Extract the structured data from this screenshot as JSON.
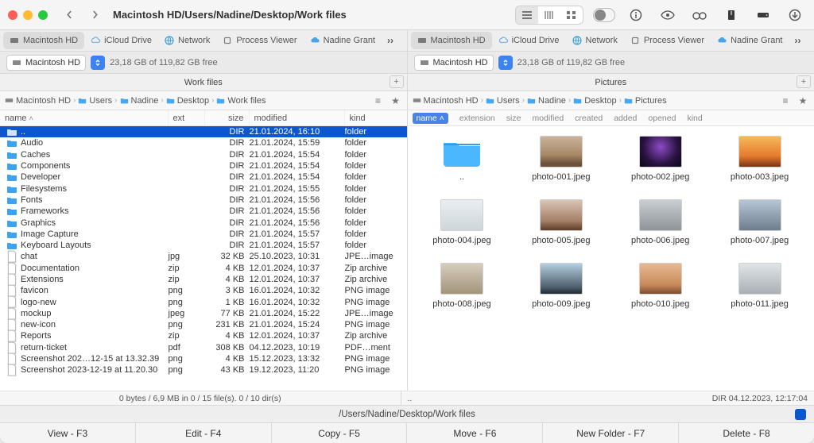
{
  "title_path": "Macintosh HD/Users/Nadine/Desktop/Work files",
  "shortcuts": [
    {
      "label": "Macintosh HD",
      "icon": "drive",
      "active": true
    },
    {
      "label": "iCloud Drive",
      "icon": "cloud"
    },
    {
      "label": "Network",
      "icon": "globe"
    },
    {
      "label": "Process Viewer",
      "icon": "cpu"
    },
    {
      "label": "Nadine Grant",
      "icon": "cloud-user"
    }
  ],
  "drive_label": "Macintosh HD",
  "free_space": "23,18 GB of 119,82 GB free",
  "left_tab": "Work files",
  "right_tab": "Pictures",
  "breadcrumbs_left": [
    "Macintosh HD",
    "Users",
    "Nadine",
    "Desktop",
    "Work files"
  ],
  "breadcrumbs_right": [
    "Macintosh HD",
    "Users",
    "Nadine",
    "Desktop",
    "Pictures"
  ],
  "list_headers": {
    "name": "name",
    "ext": "ext",
    "size": "size",
    "modified": "modified",
    "kind": "kind"
  },
  "grid_headers": [
    "name",
    "extension",
    "size",
    "modified",
    "created",
    "added",
    "opened",
    "kind"
  ],
  "list_rows": [
    {
      "name": "..",
      "ext": "",
      "size": "DIR",
      "mod": "21.01.2024, 16:10",
      "kind": "folder",
      "type": "up",
      "sel": true
    },
    {
      "name": "Audio",
      "ext": "",
      "size": "DIR",
      "mod": "21.01.2024, 15:59",
      "kind": "folder",
      "type": "folder"
    },
    {
      "name": "Caches",
      "ext": "",
      "size": "DIR",
      "mod": "21.01.2024, 15:54",
      "kind": "folder",
      "type": "folder"
    },
    {
      "name": "Components",
      "ext": "",
      "size": "DIR",
      "mod": "21.01.2024, 15:54",
      "kind": "folder",
      "type": "folder"
    },
    {
      "name": "Developer",
      "ext": "",
      "size": "DIR",
      "mod": "21.01.2024, 15:54",
      "kind": "folder",
      "type": "folder"
    },
    {
      "name": "Filesystems",
      "ext": "",
      "size": "DIR",
      "mod": "21.01.2024, 15:55",
      "kind": "folder",
      "type": "folder"
    },
    {
      "name": "Fonts",
      "ext": "",
      "size": "DIR",
      "mod": "21.01.2024, 15:56",
      "kind": "folder",
      "type": "folder"
    },
    {
      "name": "Frameworks",
      "ext": "",
      "size": "DIR",
      "mod": "21.01.2024, 15:56",
      "kind": "folder",
      "type": "folder"
    },
    {
      "name": "Graphics",
      "ext": "",
      "size": "DIR",
      "mod": "21.01.2024, 15:56",
      "kind": "folder",
      "type": "folder"
    },
    {
      "name": "Image Capture",
      "ext": "",
      "size": "DIR",
      "mod": "21.01.2024, 15:57",
      "kind": "folder",
      "type": "folder"
    },
    {
      "name": "Keyboard Layouts",
      "ext": "",
      "size": "DIR",
      "mod": "21.01.2024, 15:57",
      "kind": "folder",
      "type": "folder"
    },
    {
      "name": "chat",
      "ext": "jpg",
      "size": "32 KB",
      "mod": "25.10.2023, 10:31",
      "kind": "JPE…image",
      "type": "file"
    },
    {
      "name": "Documentation",
      "ext": "zip",
      "size": "4 KB",
      "mod": "12.01.2024, 10:37",
      "kind": "Zip archive",
      "type": "file"
    },
    {
      "name": "Extensions",
      "ext": "zip",
      "size": "4 KB",
      "mod": "12.01.2024, 10:37",
      "kind": "Zip archive",
      "type": "file"
    },
    {
      "name": "favicon",
      "ext": "png",
      "size": "3 KB",
      "mod": "16.01.2024, 10:32",
      "kind": "PNG image",
      "type": "file"
    },
    {
      "name": "logo-new",
      "ext": "png",
      "size": "1 KB",
      "mod": "16.01.2024, 10:32",
      "kind": "PNG image",
      "type": "file"
    },
    {
      "name": "mockup",
      "ext": "jpeg",
      "size": "77 KB",
      "mod": "21.01.2024, 15:22",
      "kind": "JPE…image",
      "type": "file"
    },
    {
      "name": "new-icon",
      "ext": "png",
      "size": "231 KB",
      "mod": "21.01.2024, 15:24",
      "kind": "PNG image",
      "type": "file"
    },
    {
      "name": "Reports",
      "ext": "zip",
      "size": "4 KB",
      "mod": "12.01.2024, 10:37",
      "kind": "Zip archive",
      "type": "file"
    },
    {
      "name": "return-ticket",
      "ext": "pdf",
      "size": "308 KB",
      "mod": "04.12.2023, 10:19",
      "kind": "PDF…ment",
      "type": "file"
    },
    {
      "name": "Screenshot 202…12-15 at 13.32.39",
      "ext": "png",
      "size": "4 KB",
      "mod": "15.12.2023, 13:32",
      "kind": "PNG image",
      "type": "file"
    },
    {
      "name": "Screenshot 2023-12-19 at 11.20.30",
      "ext": "png",
      "size": "43 KB",
      "mod": "19.12.2023, 11:20",
      "kind": "PNG image",
      "type": "file"
    }
  ],
  "grid_items": [
    {
      "label": "..",
      "up": true
    },
    {
      "label": "photo-001.jpeg",
      "bg": "linear-gradient(180deg,#c9b39a 0%,#a88967 60%,#6b513a 90%)"
    },
    {
      "label": "photo-002.jpeg",
      "bg": "radial-gradient(circle at 50% 35%,#8b4bc6 0%,#2a1340 60%,#0b0618 100%)"
    },
    {
      "label": "photo-003.jpeg",
      "bg": "linear-gradient(180deg,#f6b85a 0%,#e57a2e 65%,#7a3514 100%)"
    },
    {
      "label": "photo-004.jpeg",
      "bg": "linear-gradient(180deg,#e8eef1 0%,#cfd6da 100%)"
    },
    {
      "label": "photo-005.jpeg",
      "bg": "linear-gradient(180deg,#d9c4b4 0%,#a47e65 70%,#5a3c2a 100%)"
    },
    {
      "label": "photo-006.jpeg",
      "bg": "linear-gradient(180deg,#c8ced2 0%,#8e9498 100%)"
    },
    {
      "label": "photo-007.jpeg",
      "bg": "linear-gradient(180deg,#b6c6d5 0%,#6e7d8c 100%)"
    },
    {
      "label": "photo-008.jpeg",
      "bg": "linear-gradient(180deg,#d7cdbc 0%,#a3947c 100%)"
    },
    {
      "label": "photo-009.jpeg",
      "bg": "linear-gradient(180deg,#b5cfe1 0%,#4b5b68 80%,#1f2a33 100%)"
    },
    {
      "label": "photo-010.jpeg",
      "bg": "linear-gradient(180deg,#e7b993 0%,#c98a5a 70%,#7a4d2f 100%)"
    },
    {
      "label": "photo-011.jpeg",
      "bg": "linear-gradient(180deg,#dfe4e7 0%,#aab0b5 100%)"
    }
  ],
  "left_status": "0 bytes / 6,9 MB in 0 / 15 file(s). 0 / 10 dir(s)",
  "right_status_left": "..",
  "right_status_right": "DIR   04.12.2023, 12:17:04",
  "path_display": "/Users/Nadine/Desktop/Work files",
  "commands": [
    "View - F3",
    "Edit - F4",
    "Copy - F5",
    "Move - F6",
    "New Folder - F7",
    "Delete - F8"
  ]
}
